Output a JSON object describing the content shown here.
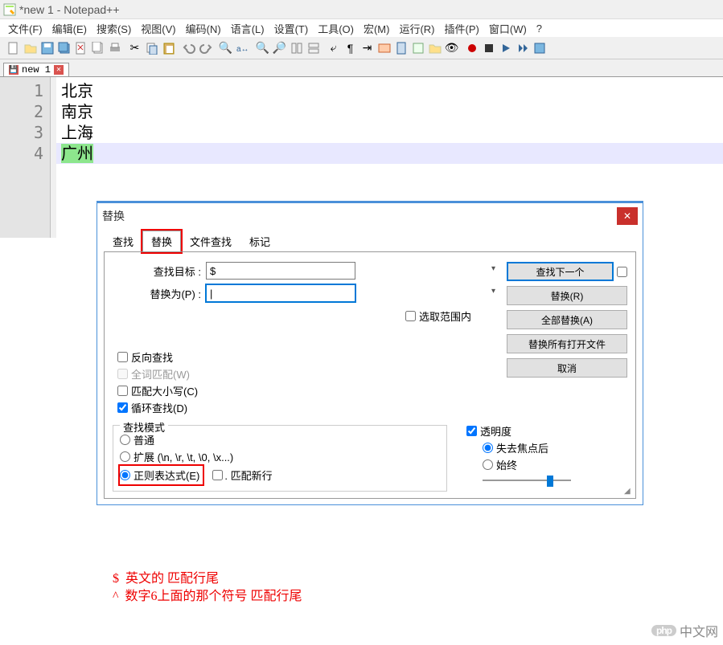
{
  "window": {
    "title": "*new 1 - Notepad++"
  },
  "menu": [
    "文件(F)",
    "编辑(E)",
    "搜索(S)",
    "视图(V)",
    "编码(N)",
    "语言(L)",
    "设置(T)",
    "工具(O)",
    "宏(M)",
    "运行(R)",
    "插件(P)",
    "窗口(W)",
    "?"
  ],
  "tab": {
    "name": "new 1"
  },
  "editor": {
    "lines": [
      "北京",
      "南京",
      "上海",
      "广州"
    ],
    "highlighted_line_index": 3
  },
  "dialog": {
    "title": "替换",
    "tabs": [
      "查找",
      "替换",
      "文件查找",
      "标记"
    ],
    "active_tab_index": 1,
    "find_label": "查找目标 :",
    "find_value": "$",
    "replace_label": "替换为(P) :",
    "replace_value": "|",
    "in_selection": "选取范围内",
    "buttons": {
      "find_next": "查找下一个",
      "replace": "替换(R)",
      "replace_all": "全部替换(A)",
      "replace_in_open": "替换所有打开文件",
      "cancel": "取消"
    },
    "options": {
      "backward": "反向查找",
      "whole_word": "全词匹配(W)",
      "match_case": "匹配大小写(C)",
      "wrap": "循环查找(D)"
    },
    "search_mode": {
      "legend": "查找模式",
      "normal": "普通",
      "extended": "扩展 (\\n, \\r, \\t, \\0, \\x...)",
      "regex": "正则表达式(E)",
      "match_newline": ". 匹配新行"
    },
    "transparency": {
      "label": "透明度",
      "on_lose_focus": "失去焦点后",
      "always": "始终"
    }
  },
  "annotations": {
    "line1_a": "$",
    "line1_b": "英文的 匹配行尾",
    "line2_a": "^",
    "line2_b": "数字6上面的那个符号 匹配行尾"
  },
  "watermark": {
    "tag": "php",
    "text": "中文网"
  }
}
